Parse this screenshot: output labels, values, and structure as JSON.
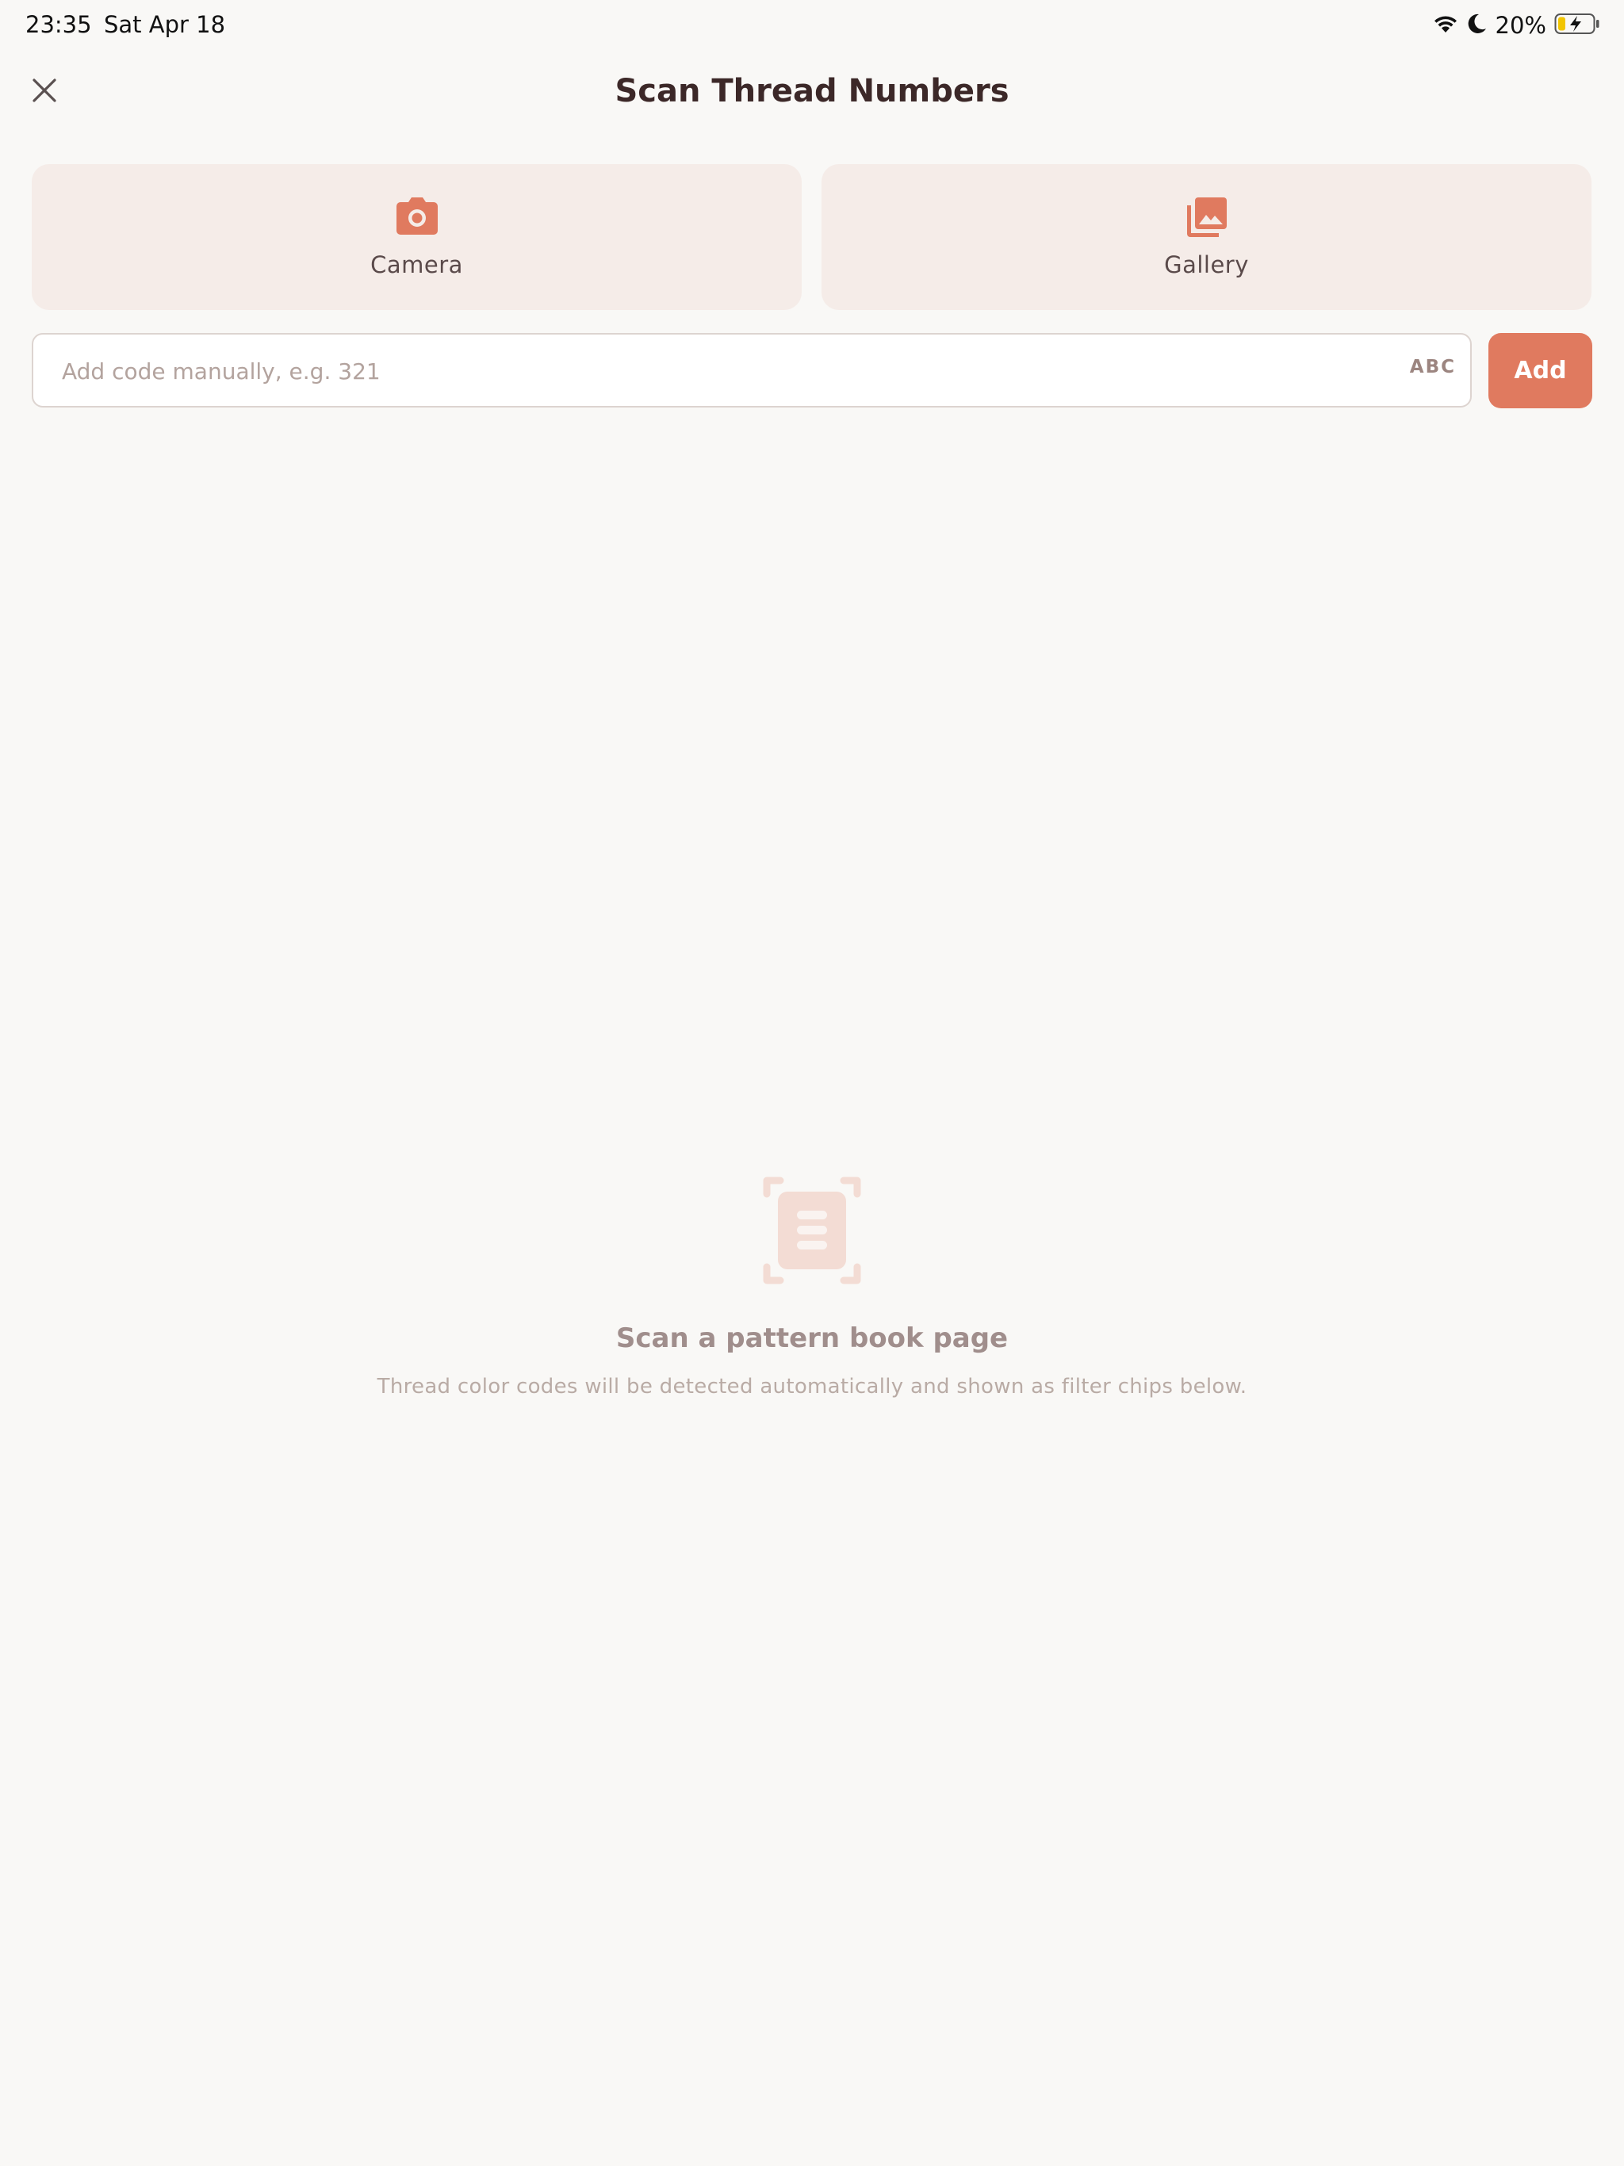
{
  "status_bar": {
    "time": "23:35",
    "date": "Sat Apr 18",
    "battery_percent": "20%",
    "icons": [
      "wifi-icon",
      "moon-icon",
      "battery-charging-icon"
    ]
  },
  "header": {
    "title": "Scan Thread Numbers",
    "close_icon": "close-icon"
  },
  "sources": {
    "camera": {
      "label": "Camera",
      "icon": "camera-icon"
    },
    "gallery": {
      "label": "Gallery",
      "icon": "gallery-icon"
    }
  },
  "manual_entry": {
    "value": "",
    "placeholder": "Add code manually, e.g. 321",
    "keyboard_toggle": "ABC",
    "add_label": "Add"
  },
  "empty_state": {
    "icon": "document-scan-icon",
    "title": "Scan a pattern book page",
    "description": "Thread color codes will be detected automatically and shown as filter chips below."
  },
  "colors": {
    "accent": "#e07a5f",
    "card_background": "#f5ece8",
    "page_background": "#f9f8f6",
    "title_text": "#3c2828",
    "empty_icon": "#f3dcd4"
  }
}
